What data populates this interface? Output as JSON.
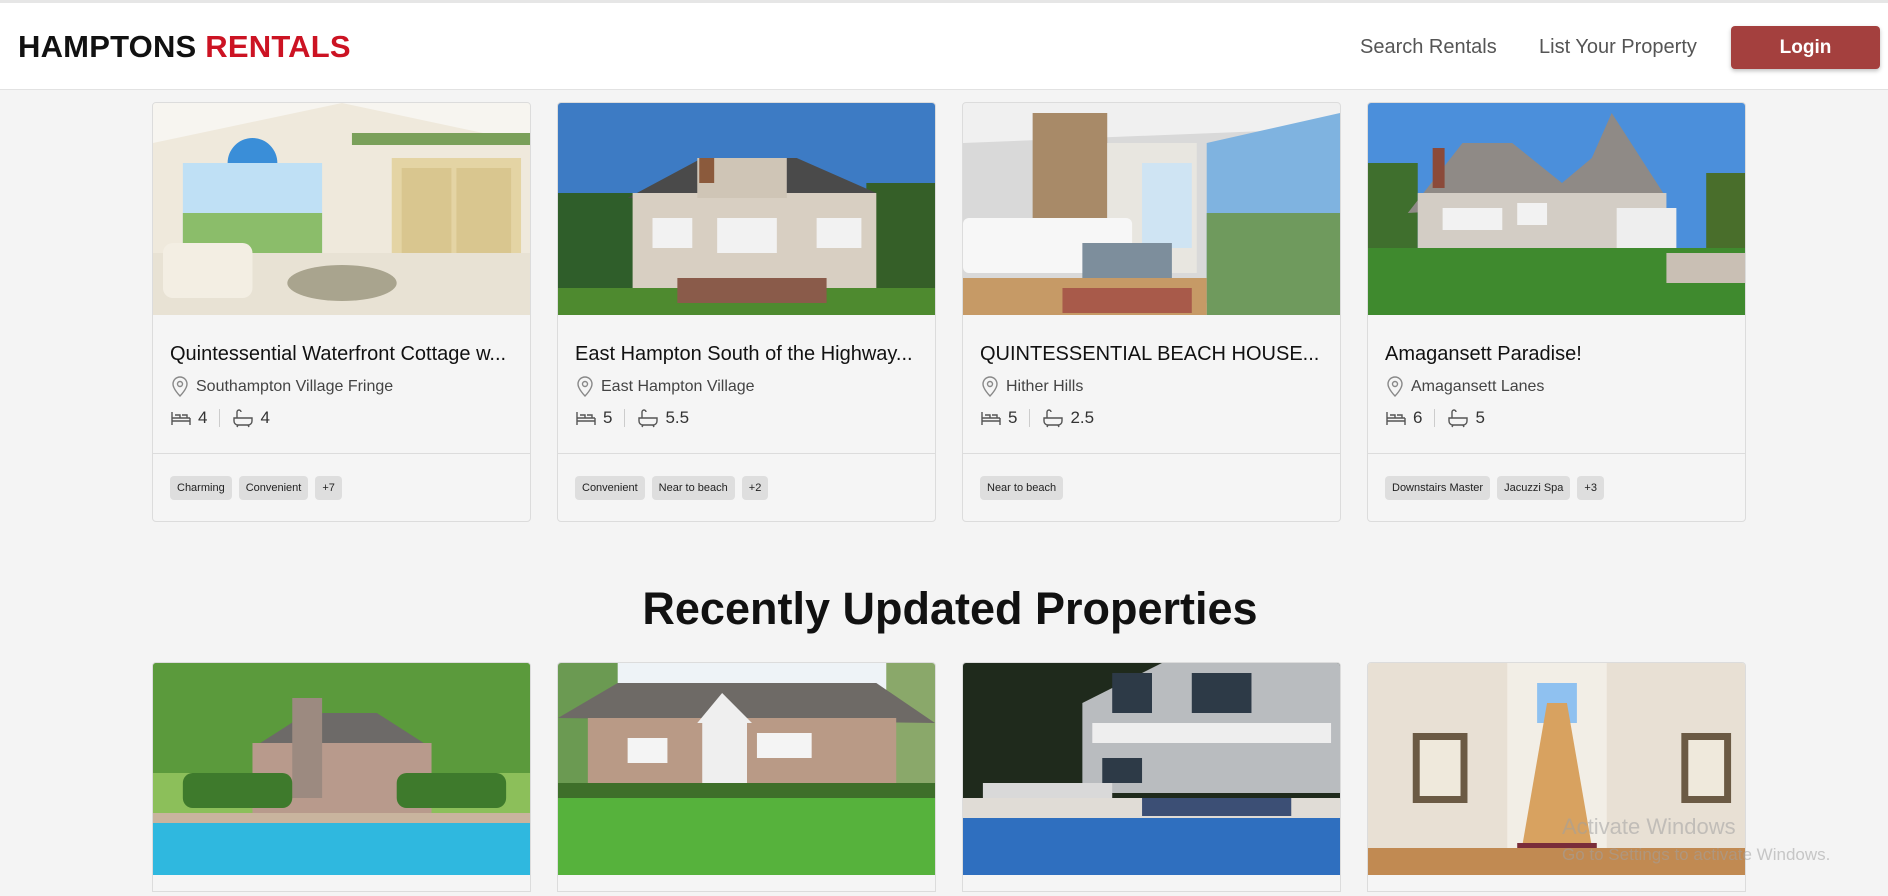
{
  "brand": {
    "part1": "HAMPTONS",
    "part2": "RENTALS"
  },
  "nav": {
    "search": "Search Rentals",
    "list": "List Your Property",
    "login": "Login"
  },
  "featured": [
    {
      "title": "Quintessential Waterfront Cottage w...",
      "location": "Southampton Village Fringe",
      "beds": "4",
      "baths": "4",
      "tags": [
        "Charming",
        "Convenient",
        "+7"
      ]
    },
    {
      "title": "East Hampton South of the Highway...",
      "location": "East Hampton Village",
      "beds": "5",
      "baths": "5.5",
      "tags": [
        "Convenient",
        "Near to beach",
        "+2"
      ]
    },
    {
      "title": "QUINTESSENTIAL BEACH HOUSE...",
      "location": "Hither Hills",
      "beds": "5",
      "baths": "2.5",
      "tags": [
        "Near to beach"
      ]
    },
    {
      "title": "Amagansett Paradise!",
      "location": "Amagansett Lanes",
      "beds": "6",
      "baths": "5",
      "tags": [
        "Downstairs Master",
        "Jacuzzi Spa",
        "+3"
      ]
    }
  ],
  "recent": {
    "title": "Recently Updated Properties"
  },
  "watermark": {
    "line1": "Activate Windows",
    "line2": "Go to Settings to activate Windows."
  },
  "icons": {
    "location": "map-pin-icon",
    "bed": "bed-icon",
    "bath": "bathtub-icon"
  },
  "colors": {
    "brand_red": "#cc1323",
    "login_bg": "#a4403e"
  }
}
